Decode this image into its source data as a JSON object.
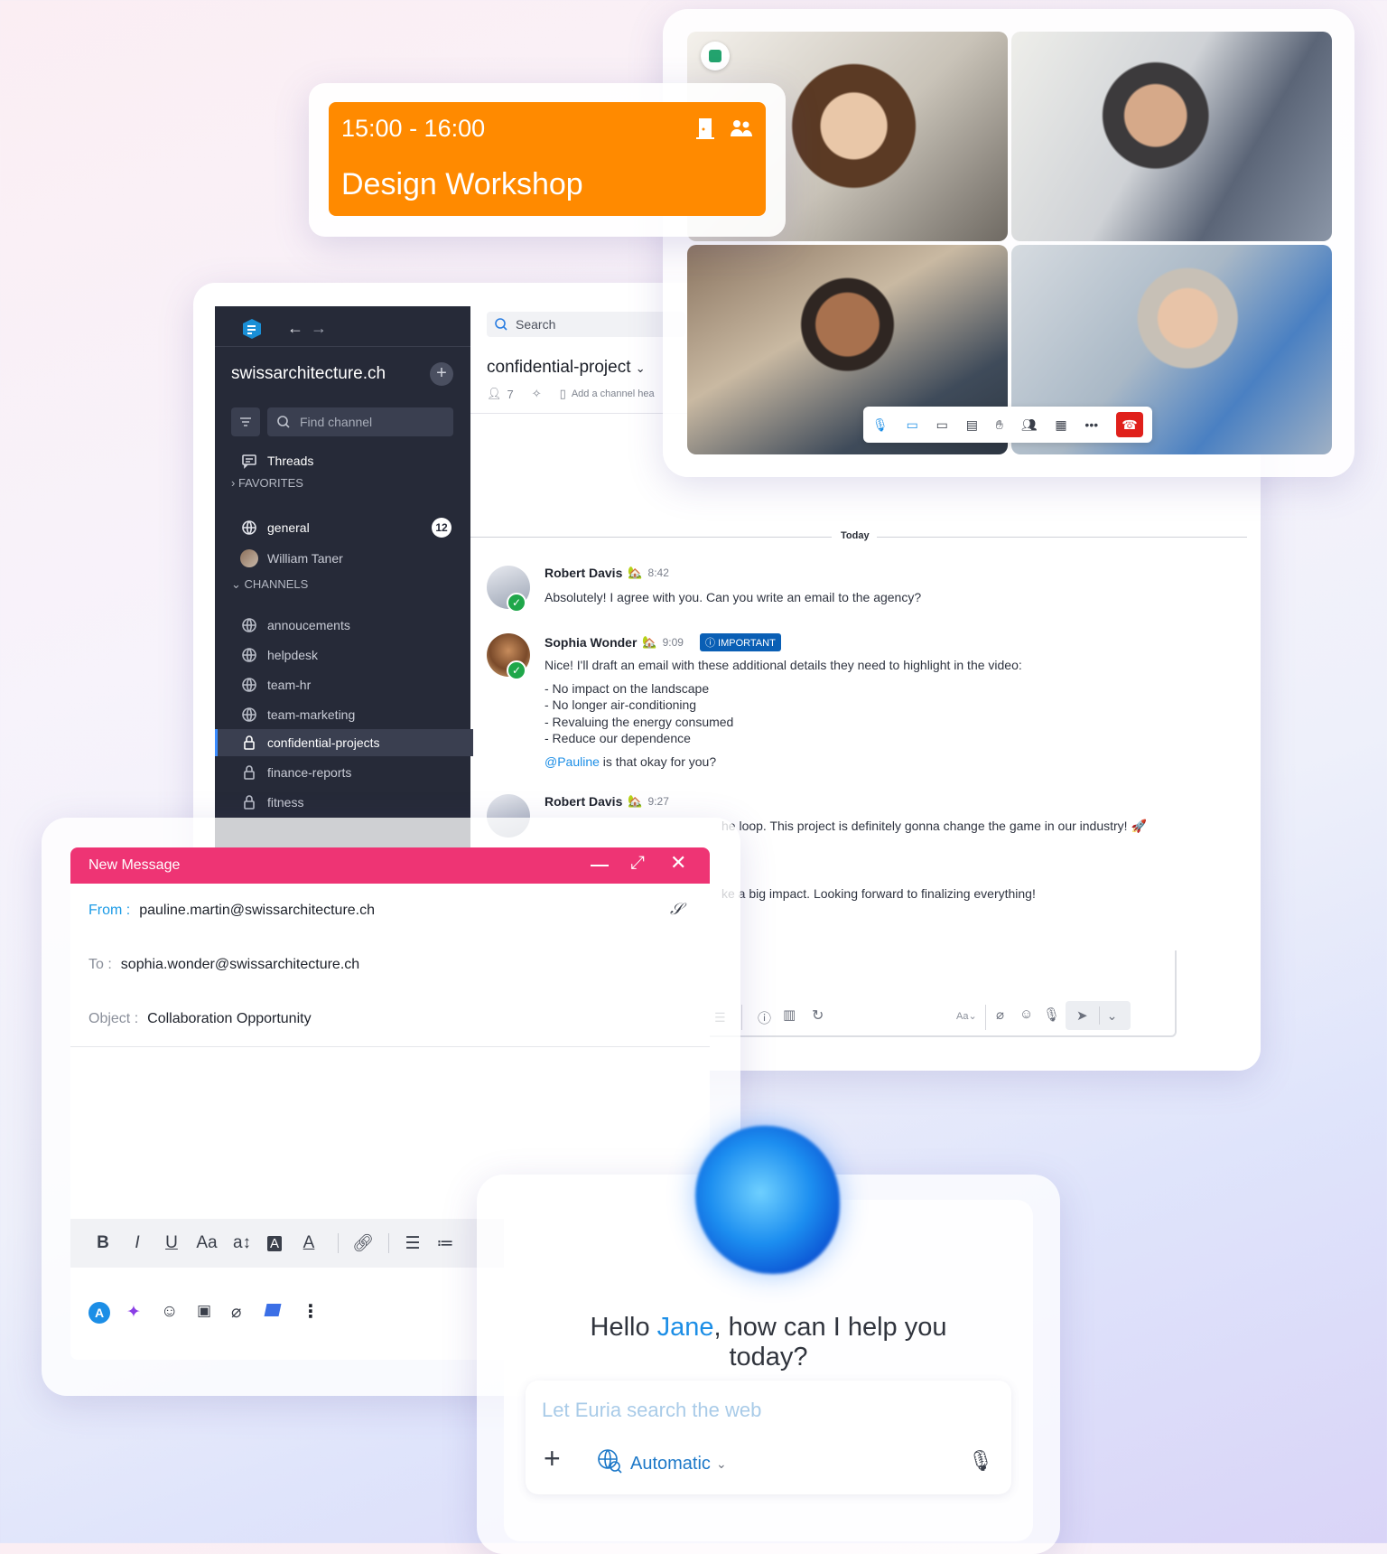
{
  "event": {
    "time": "15:00 - 16:00",
    "title": "Design Workshop",
    "bg_color": "#ff8a00"
  },
  "video": {
    "controls": [
      "mic-icon",
      "camera-icon",
      "screen-share-icon",
      "chat-icon",
      "raise-hand-icon",
      "participants-icon",
      "grid-icon",
      "more-icon",
      "hangup-icon"
    ]
  },
  "sidebar": {
    "org": "swissarchitecture.ch",
    "find_placeholder": "Find channel",
    "threads": "Threads",
    "favorites_header": "FAVORITES",
    "favorites": [
      {
        "label": "general",
        "badge": "12"
      },
      {
        "label": "William Taner"
      }
    ],
    "channels_header": "CHANNELS",
    "channels": [
      {
        "label": "annoucements",
        "locked": false
      },
      {
        "label": "helpdesk",
        "locked": false
      },
      {
        "label": "team-hr",
        "locked": false
      },
      {
        "label": "team-marketing",
        "locked": false
      },
      {
        "label": "confidential-projects",
        "locked": true,
        "active": true
      },
      {
        "label": "finance-reports",
        "locked": true
      },
      {
        "label": "fitness",
        "locked": true
      }
    ]
  },
  "channel": {
    "search_placeholder": "Search",
    "name": "confidential-project",
    "members": "7",
    "header_placeholder": "Add a channel hea",
    "date_divider": "Today"
  },
  "messages": [
    {
      "author": "Robert Davis",
      "time": "8:42",
      "text": "Absolutely! I agree with you. Can you write an email to the agency?"
    },
    {
      "author": "Sophia Wonder",
      "time": "9:09",
      "tag": "IMPORTANT",
      "text": "Nice! I'll draft an email with these additional details they need to highlight in the video:",
      "bullets": [
        "- No impact on the landscape",
        "- No longer air-conditioning",
        "- Revaluing the energy consumed",
        "- Reduce our dependence"
      ],
      "mention": "@Pauline",
      "mention_rest": " is that okay for you?"
    },
    {
      "author": "Robert Davis",
      "time": "9:27",
      "text_a": "he loop. This project is definitely gonna change the game in our industry! 🚀",
      "text_b": "ke a big impact. Looking forward to finalizing everything!"
    }
  ],
  "composer": {
    "font_label": "Aa"
  },
  "mail": {
    "title": "New Message",
    "from_label": "From :",
    "from_value": "pauline.martin@swissarchitecture.ch",
    "to_label": "To :",
    "to_value": "sophia.wonder@swissarchitecture.ch",
    "object_label": "Object :",
    "object_value": "Collaboration Opportunity",
    "toolbar": [
      "B",
      "I",
      "U",
      "Aa",
      "a↕",
      "A",
      "A"
    ],
    "header_color": "#ee3474"
  },
  "ai": {
    "greeting_pre": "Hello ",
    "greeting_name": "Jane",
    "greeting_post": ", how can I help you today?",
    "placeholder": "Let Euria search the web",
    "mode": "Automatic"
  }
}
